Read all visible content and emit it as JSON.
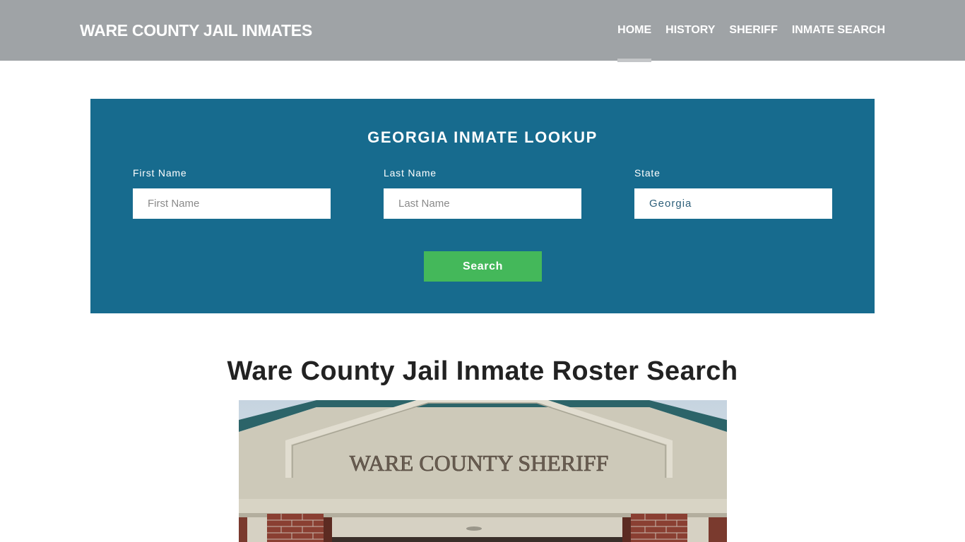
{
  "header": {
    "brand": "WARE COUNTY JAIL INMATES",
    "nav": [
      {
        "label": "HOME",
        "active": true
      },
      {
        "label": "HISTORY",
        "active": false
      },
      {
        "label": "SHERIFF",
        "active": false
      },
      {
        "label": "INMATE SEARCH",
        "active": false
      }
    ]
  },
  "lookup": {
    "title": "GEORGIA INMATE LOOKUP",
    "first_name": {
      "label": "First Name",
      "placeholder": "First Name",
      "value": ""
    },
    "last_name": {
      "label": "Last Name",
      "placeholder": "Last Name",
      "value": ""
    },
    "state": {
      "label": "State",
      "value": "Georgia"
    },
    "search_label": "Search",
    "colors": {
      "panel": "#176b8e",
      "button": "#44b85a"
    }
  },
  "main": {
    "heading": "Ware County Jail Inmate Roster Search",
    "image": {
      "sign_text": "WARE COUNTY SHERIFF",
      "alt": "Ware County Sheriff building facade"
    }
  }
}
